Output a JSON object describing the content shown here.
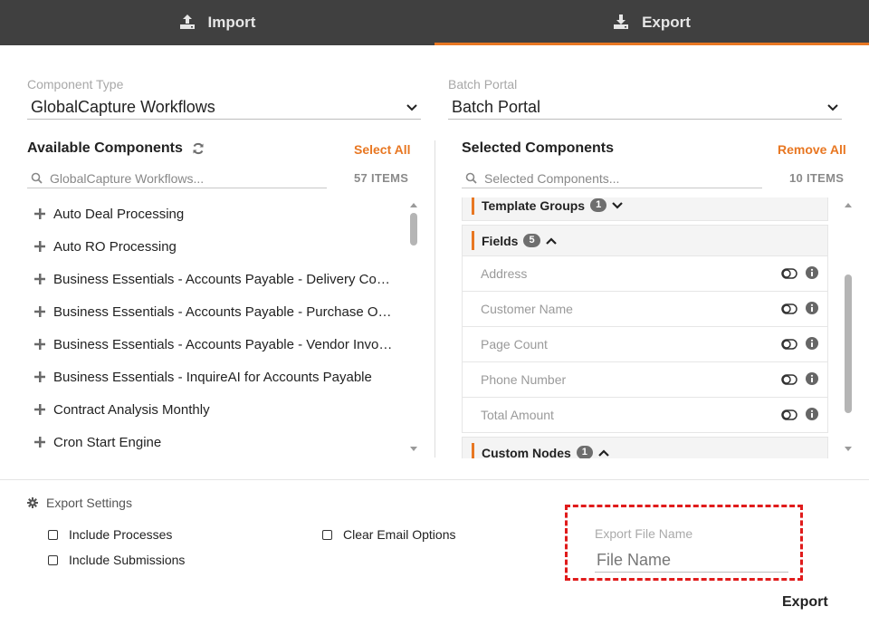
{
  "tabs": [
    {
      "label": "Import",
      "icon": "upload-icon",
      "active": false
    },
    {
      "label": "Export",
      "icon": "download-icon",
      "active": true
    }
  ],
  "accent_color": "#e87722",
  "component_type": {
    "label": "Component Type",
    "value": "GlobalCapture Workflows"
  },
  "batch_portal": {
    "label": "Batch Portal",
    "value": "Batch Portal"
  },
  "available": {
    "title": "Available Components",
    "select_all": "Select All",
    "search_placeholder": "GlobalCapture Workflows...",
    "count": "57 ITEMS",
    "items": [
      "Auto Deal Processing",
      "Auto RO Processing",
      "Business Essentials - Accounts Payable - Delivery Co…",
      "Business Essentials - Accounts Payable - Purchase O…",
      "Business Essentials - Accounts Payable - Vendor Invo…",
      "Business Essentials - InquireAI for Accounts Payable",
      "Contract Analysis Monthly",
      "Cron Start Engine"
    ]
  },
  "selected": {
    "title": "Selected Components",
    "remove_all": "Remove All",
    "search_placeholder": "Selected Components...",
    "count": "10 ITEMS",
    "groups": [
      {
        "name": "Template Groups",
        "count": "1",
        "expanded": false
      },
      {
        "name": "Fields",
        "count": "5",
        "expanded": true,
        "fields": [
          "Address",
          "Customer Name",
          "Page Count",
          "Phone Number",
          "Total Amount"
        ]
      },
      {
        "name": "Custom Nodes",
        "count": "1",
        "expanded": true
      }
    ]
  },
  "export_settings": {
    "title": "Export Settings",
    "options": [
      {
        "label": "Include Processes",
        "checked": false
      },
      {
        "label": "Include Submissions",
        "checked": false
      },
      {
        "label": "Clear Email Options",
        "checked": false
      }
    ]
  },
  "export_file": {
    "label": "Export File Name",
    "placeholder": "File Name"
  },
  "export_button": "Export"
}
